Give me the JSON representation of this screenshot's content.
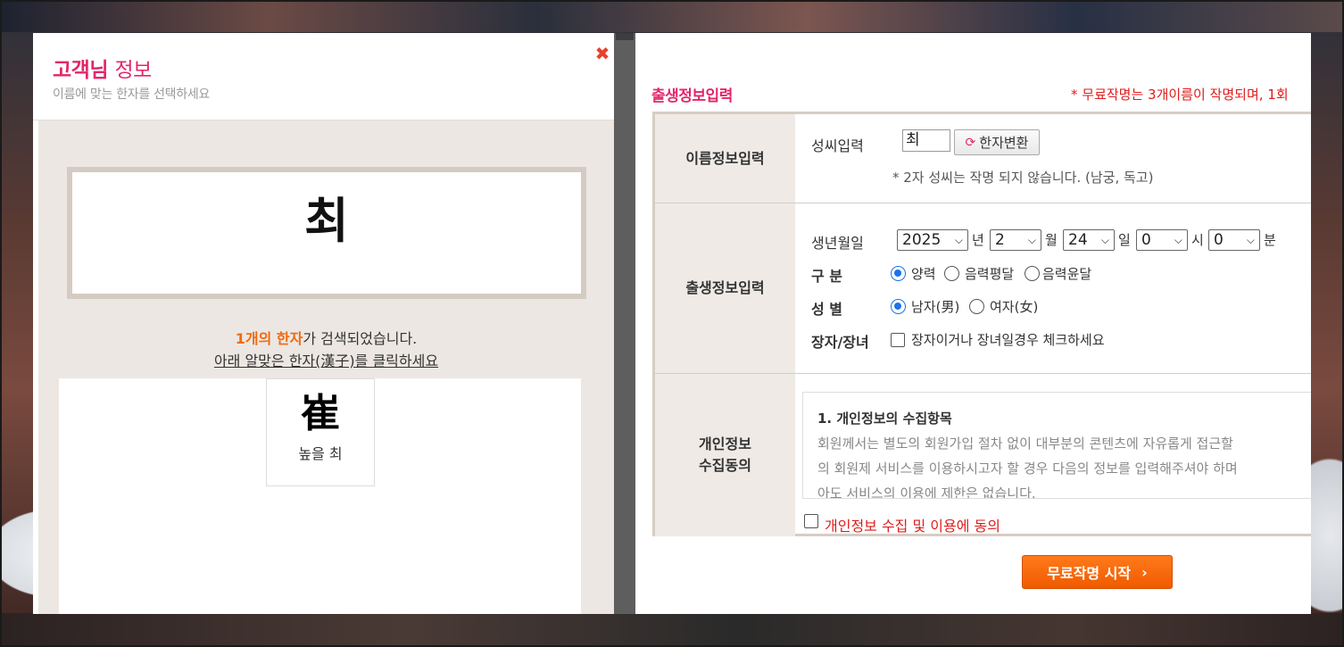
{
  "left": {
    "title_strong": "고객님",
    "title_light": "정보",
    "subtitle": "이름에 맞는 한자를 선택하세요",
    "close_glyph": "✖",
    "name_char": "최",
    "found_highlight": "1개의 한자",
    "found_rest": "가 검색되었습니다.",
    "click_hint": "아래 알맞은 한자(漢子)를 클릭하세요",
    "hanja_results": [
      {
        "char": "崔",
        "meaning": "높을 최"
      }
    ]
  },
  "right": {
    "title": "출생정보입력",
    "note": "* 무료작명는 3개이름이 작명되며, 1회",
    "sections": {
      "name": {
        "head": "이름정보입력",
        "surname_label": "성씨입력",
        "surname_value": "최",
        "convert_button": "한자변환",
        "note": "* 2자 성씨는 작명 되지 않습니다. (남궁, 독고)"
      },
      "birth": {
        "head": "출생정보입력",
        "birth_label": "생년월일",
        "year": "2025",
        "year_unit": "년",
        "month": "2",
        "month_unit": "월",
        "day": "24",
        "day_unit": "일",
        "hour": "0",
        "hour_unit": "시",
        "minute": "0",
        "minute_unit": "분",
        "calendar_label": "구 분",
        "calendar_options": [
          "양력",
          "음력평달",
          "음력윤달"
        ],
        "gender_label": "성 별",
        "gender_options": [
          "남자(男)",
          "여자(女)"
        ],
        "firstborn_label": "장자/장녀",
        "firstborn_text": "장자이거나 장녀일경우 체크하세요"
      },
      "privacy": {
        "head_line1": "개인정보",
        "head_line2": "수집동의",
        "box_title": "1. 개인정보의 수집항목",
        "box_lines": [
          "회원께서는 별도의 회원가입 절차 없이 대부분의 콘텐츠에 자유롭게 접근할",
          "의 회원제 서비스를 이용하시고자 할 경우 다음의 정보를 입력해주셔야 하며",
          "아도 서비스의 이용에 제한은 없습니다."
        ],
        "agree_text": "개인정보 수집 및 이용에 동의"
      }
    },
    "start_button": "무료작명 시작",
    "start_arrow": "›"
  },
  "colors": {
    "accent_pink": "#e3266a",
    "accent_orange": "#ee6b12",
    "warning_red": "#e01b1b",
    "button_orange": "#f05a00"
  }
}
